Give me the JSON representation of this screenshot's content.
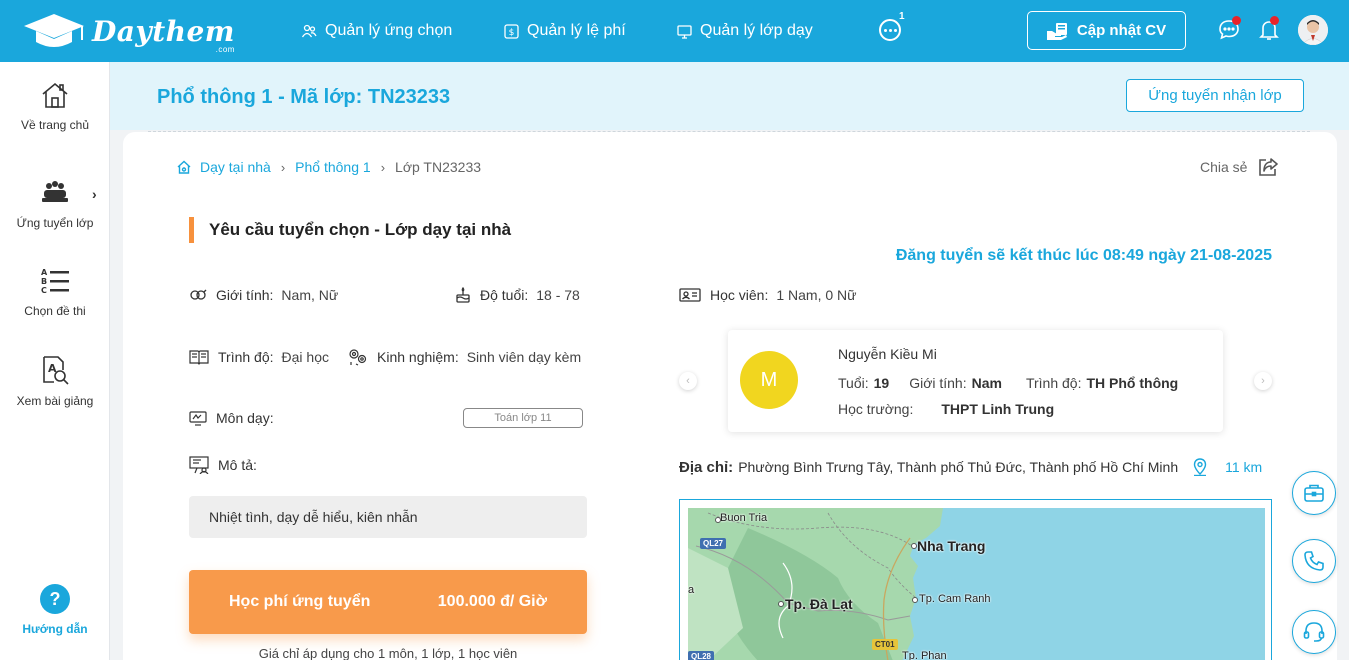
{
  "header": {
    "logo_text": "Daythem",
    "logo_suffix": ".com",
    "nav": [
      {
        "label": "Quản lý ứng chọn",
        "icon": "users-icon"
      },
      {
        "label": "Quản lý lệ phí",
        "icon": "dollar-icon"
      },
      {
        "label": "Quản lý lớp dạy",
        "icon": "monitor-icon"
      }
    ],
    "more_badge": "1",
    "cv_button": "Cập nhật CV",
    "colors": {
      "primary": "#1aa7dc",
      "accent": "#f89a4b",
      "badge": "#e8232a"
    }
  },
  "sidebar": {
    "items": [
      {
        "label": "Về trang chủ",
        "icon": "home-icon"
      },
      {
        "label": "Ứng tuyển lớp",
        "icon": "group-icon"
      },
      {
        "label": "Chọn đề thi",
        "icon": "abc-list-icon"
      },
      {
        "label": "Xem bài giảng",
        "icon": "document-search-icon"
      }
    ],
    "help_label": "Hướng dẫn"
  },
  "page": {
    "title": "Phổ thông 1 - Mã lớp: TN23233",
    "apply_button": "Ứng tuyển nhận lớp",
    "breadcrumb": [
      "Dạy tại nhà",
      "Phổ thông 1",
      "Lớp TN23233"
    ],
    "share_label": "Chia sẻ",
    "section_title": "Yêu cầu tuyển chọn - Lớp dạy tại nhà",
    "deadline": "Đăng tuyển sẽ kết thúc lúc 08:49 ngày 21-08-2025"
  },
  "requirements": {
    "gender_label": "Giới tính:",
    "gender_value": "Nam, Nữ",
    "age_label": "Độ tuổi:",
    "age_value": "18 - 78",
    "level_label": "Trình độ:",
    "level_value": "Đại học",
    "experience_label": "Kinh nghiệm:",
    "experience_value": "Sinh viên dạy kèm",
    "subject_label": "Môn dạy:",
    "subject_value": "Toán lớp 11",
    "description_label": "Mô tả:",
    "description_value": "Nhiệt tình, dạy dễ hiểu, kiên nhẫn",
    "fee_label": "Học phí ứng tuyển",
    "fee_value": "100.000 đ/ Giờ",
    "fee_note": "Giá chỉ áp dụng cho 1 môn, 1 lớp, 1 học viên"
  },
  "students": {
    "label": "Học viên:",
    "value": "1 Nam, 0 Nữ",
    "card": {
      "initial": "M",
      "name": "Nguyễn Kiều Mi",
      "age_label": "Tuổi:",
      "age": "19",
      "gender_label": "Giới tính:",
      "gender": "Nam",
      "level_label": "Trình độ:",
      "level": "TH Phổ thông",
      "school_label": "Học trường:",
      "school": "THPT Linh Trung"
    }
  },
  "address": {
    "label": "Địa chỉ:",
    "value": "Phường Bình Trưng Tây, Thành phố Thủ Đức, Thành phố Hồ Chí Minh",
    "distance": "11 km"
  },
  "map": {
    "places": [
      "Buon Tria",
      "Nha Trang",
      "Tp. Đà Lạt",
      "Tp. Cam Ranh",
      "Tp. Phan"
    ],
    "roads": [
      "QL27",
      "CT01",
      "QL28"
    ],
    "edge_letter": "a"
  }
}
